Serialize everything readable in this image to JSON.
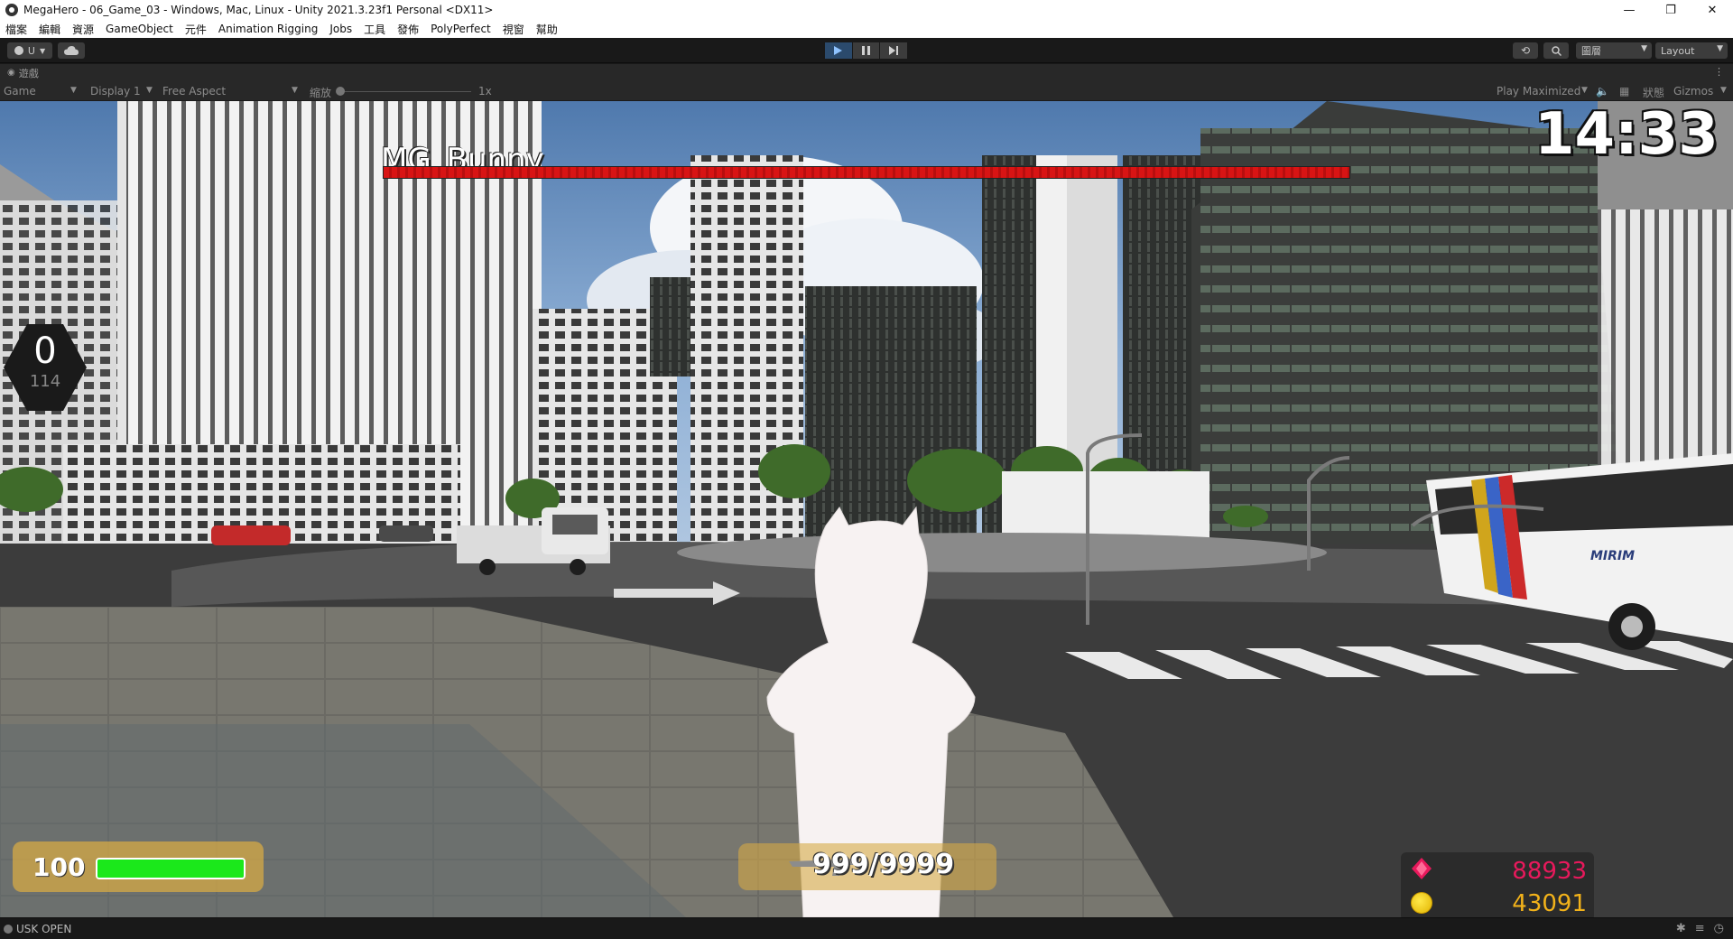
{
  "window": {
    "title": "MegaHero - 06_Game_03 - Windows, Mac, Linux - Unity 2021.3.23f1 Personal <DX11>",
    "minimize_glyph": "—",
    "maximize_glyph": "❐",
    "close_glyph": "✕"
  },
  "menu": {
    "items": [
      "檔案",
      "編輯",
      "資源",
      "GameObject",
      "元件",
      "Animation Rigging",
      "Jobs",
      "工具",
      "發佈",
      "PolyPerfect",
      "視窗",
      "幫助"
    ]
  },
  "toolbar": {
    "account_label": "U",
    "layers_label": "圖層",
    "layout_label": "Layout",
    "play_active": true
  },
  "game_view": {
    "tab_label": "遊戲",
    "display_mode": "Game",
    "display": "Display 1",
    "aspect": "Free Aspect",
    "scale_label": "縮放",
    "scale_value": "1x",
    "play_mode": "Play Maximized",
    "stats_label": "狀態",
    "gizmos_label": "Gizmos"
  },
  "hud": {
    "boss_name": "MG_Bunny",
    "boss_health_fraction": 1.0,
    "timer": "14:33",
    "combo_count": "0",
    "combo_sub": "114",
    "player_hp": "100",
    "player_hp_fraction": 1.0,
    "ammo": "999/9999",
    "gems": "88933",
    "coins": "43091",
    "bus_text": "MIRIM"
  },
  "colors": {
    "hp_green": "#1be81b",
    "boss_red": "#d81414",
    "gem_pink": "#e8195c",
    "coin_gold": "#f2b21a",
    "play_blue": "#2b4a6c"
  },
  "status": {
    "text": "USK OPEN"
  }
}
